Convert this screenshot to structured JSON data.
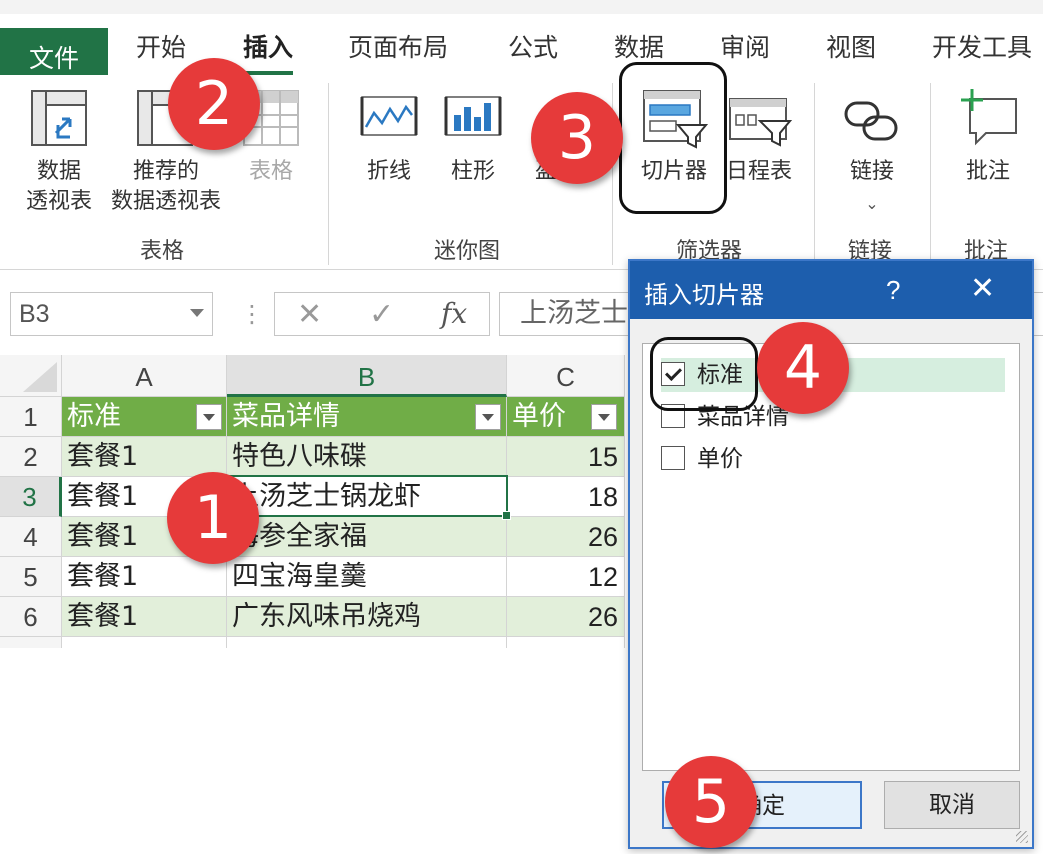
{
  "ribbon_tabs": [
    "文件",
    "开始",
    "插入",
    "页面布局",
    "公式",
    "数据",
    "审阅",
    "视图",
    "开发工具"
  ],
  "ribbon": {
    "pivot_table": [
      "数据",
      "透视表"
    ],
    "recommended_pivot": [
      "推荐的",
      "数据透视表"
    ],
    "table": "表格",
    "line": "折线",
    "column": "柱形",
    "winloss": "盈",
    "slicer": "切片器",
    "timeline": "日程表",
    "link": "链接",
    "comment": "批注",
    "groups": {
      "tables": "表格",
      "sparklines": "迷你图",
      "filters": "筛选器",
      "links": "链接",
      "comments": "批注"
    }
  },
  "formula_bar": {
    "name_box": "B3",
    "fx": "fx",
    "content": "上汤芝士锅龙虾"
  },
  "sheet": {
    "columns": [
      "A",
      "B",
      "C"
    ],
    "row_numbers": [
      "1",
      "2",
      "3",
      "4",
      "5",
      "6"
    ],
    "header": [
      "标准",
      "菜品详情",
      "单价"
    ],
    "rows": [
      [
        "套餐1",
        "特色八味碟",
        "15"
      ],
      [
        "套餐1",
        "上汤芝士锅龙虾",
        "18"
      ],
      [
        "套餐1",
        "海参全家福",
        "26"
      ],
      [
        "套餐1",
        "四宝海皇羹",
        "12"
      ],
      [
        "套餐1",
        "广东风味吊烧鸡",
        "26"
      ]
    ]
  },
  "dialog": {
    "title": "插入切片器",
    "help": "?",
    "close": "✕",
    "fields": [
      {
        "label": "标准",
        "checked": true
      },
      {
        "label": "菜品详情",
        "checked": false
      },
      {
        "label": "单价",
        "checked": false
      }
    ],
    "ok": "确定",
    "cancel": "取消"
  },
  "callouts": [
    "1",
    "2",
    "3",
    "4",
    "5"
  ],
  "colors": {
    "excel_green": "#217346",
    "table_header": "#70ad47",
    "table_band": "#e2efda",
    "dialog_title": "#1d5ead",
    "callout": "#e63a3a"
  }
}
